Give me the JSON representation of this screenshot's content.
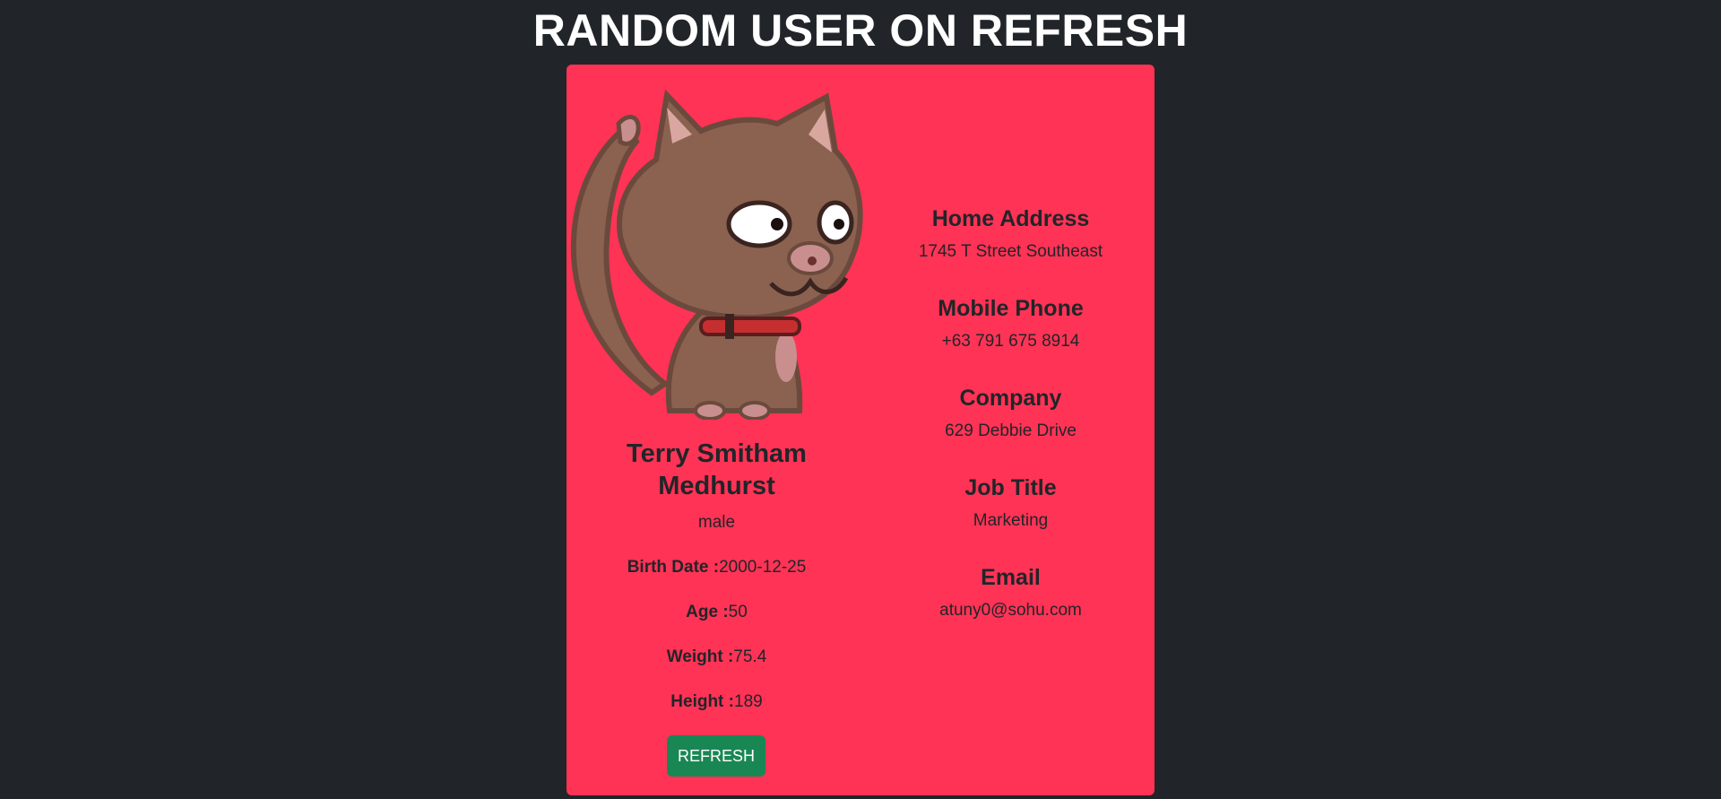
{
  "header": {
    "title": "RANDOM USER ON REFRESH"
  },
  "profile": {
    "avatar_icon": "cat-avatar-icon",
    "name": "Terry Smitham Medhurst",
    "gender": "male",
    "birth_date_label": "Birth Date :",
    "birth_date": "2000-12-25",
    "age_label": "Age :",
    "age": "50",
    "weight_label": "Weight :",
    "weight": "75.4",
    "height_label": "Height :",
    "height": "189",
    "refresh_label": "REFRESH"
  },
  "details": {
    "home_address_label": "Home Address",
    "home_address": "1745 T Street Southeast",
    "mobile_phone_label": "Mobile Phone",
    "mobile_phone": "+63 791 675 8914",
    "company_label": "Company",
    "company": "629 Debbie Drive",
    "job_title_label": "Job Title",
    "job_title": "Marketing",
    "email_label": "Email",
    "email": "atuny0@sohu.com"
  },
  "colors": {
    "background": "#212529",
    "card": "#ff3355",
    "button": "#198754"
  }
}
